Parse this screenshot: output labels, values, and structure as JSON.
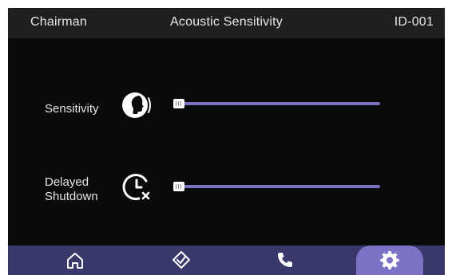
{
  "header": {
    "left_label": "Chairman",
    "title": "Acoustic Sensitivity",
    "device_id": "ID-001"
  },
  "rows": [
    {
      "label": "Sensitivity",
      "icon": "speaking-head-icon",
      "value_fraction": 0.0
    },
    {
      "label": "Delayed Shutdown",
      "label_line1": "Delayed",
      "label_line2": "Shutdown",
      "icon": "clock-cancel-icon",
      "value_fraction": 0.0
    }
  ],
  "nav": {
    "items": [
      {
        "icon": "home-icon",
        "active": false
      },
      {
        "icon": "check-shield-icon",
        "active": false
      },
      {
        "icon": "phone-icon",
        "active": false
      },
      {
        "icon": "gear-icon",
        "active": true
      }
    ]
  },
  "colors": {
    "background": "#0a0a0a",
    "header": "#1f1f1f",
    "bottom_bar": "#3a376b",
    "accent": "#7c73c6",
    "slider_track": "#7a72c0"
  }
}
